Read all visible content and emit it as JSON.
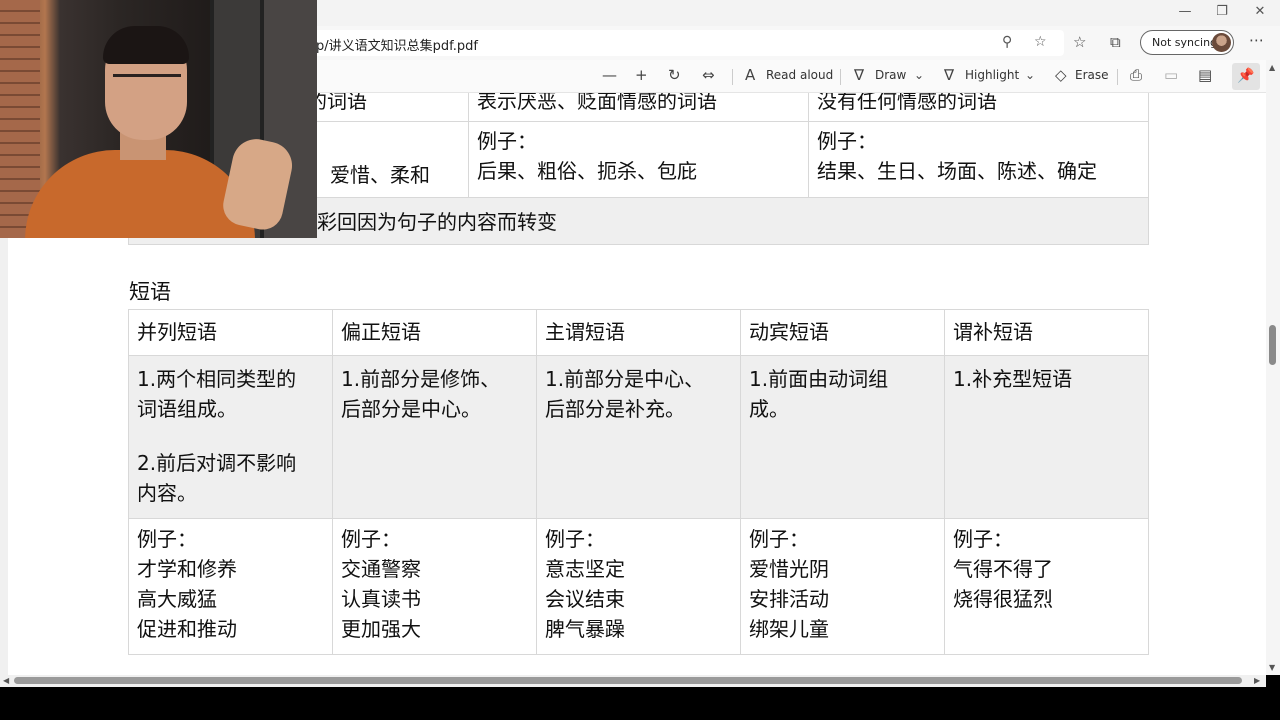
{
  "browser": {
    "address": "p/讲义语文知识总集pdf.pdf",
    "sync_label": "Not syncing",
    "window_controls": [
      "minimize",
      "restore",
      "close"
    ]
  },
  "pdf_toolbar": {
    "read_aloud": "Read aloud",
    "draw": "Draw",
    "highlight": "Highlight",
    "erase": "Erase"
  },
  "upper_table": {
    "header": [
      "感的词语",
      "表示厌恶、贬面情感的词语",
      "没有任何情感的词语"
    ],
    "examples": [
      [
        "爱惜、柔和"
      ],
      [
        "例子：",
        "后果、粗俗、扼杀、包庇"
      ],
      [
        "例子：",
        "结果、生日、场面、陈述、确定"
      ]
    ],
    "note": "彩回因为句子的内容而转变"
  },
  "phrases": {
    "title": "短语",
    "columns": [
      "并列短语",
      "偏正短语",
      "主谓短语",
      "动宾短语",
      "谓补短语"
    ],
    "descriptions": [
      [
        "1.两个相同类型的",
        "词语组成。",
        "",
        "2.前后对调不影响",
        "内容。"
      ],
      [
        "1.前部分是修饰、",
        "后部分是中心。"
      ],
      [
        "1.前部分是中心、",
        "后部分是补充。"
      ],
      [
        "1.前面由动词组",
        "成。"
      ],
      [
        "1.补充型短语"
      ]
    ],
    "examples": [
      [
        "例子：",
        "才学和修养",
        "高大威猛",
        "促进和推动"
      ],
      [
        "例子：",
        "交通警察",
        "认真读书",
        "更加强大"
      ],
      [
        "例子：",
        "意志坚定",
        "会议结束",
        "脾气暴躁"
      ],
      [
        "例子：",
        "爱惜光阴",
        "安排活动",
        "绑架儿童"
      ],
      [
        "例子：",
        "气得不得了",
        "烧得很猛烈"
      ]
    ]
  }
}
